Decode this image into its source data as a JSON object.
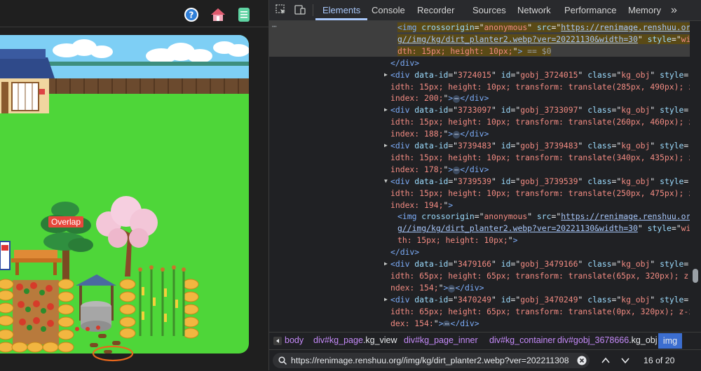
{
  "page": {
    "overlap_label": "Overlap"
  },
  "top_icons": [
    "help-icon",
    "home-icon",
    "notes-icon"
  ],
  "devtools": {
    "tabs": [
      {
        "label": "Elements",
        "active": true
      },
      {
        "label": "Console"
      },
      {
        "label": "Recorder"
      },
      {
        "label": "Sources"
      },
      {
        "label": "Network"
      },
      {
        "label": "Performance"
      },
      {
        "label": "Memory"
      }
    ],
    "more_tabs": "»",
    "code_lines": [
      {
        "segs": [
          [
            "tg",
            "<img "
          ],
          [
            "an",
            "crossorigin"
          ],
          [
            "pl",
            "=\""
          ],
          [
            "av",
            "anonymous"
          ],
          [
            "pl",
            "\" "
          ],
          [
            "an",
            "src"
          ],
          [
            "pl",
            "=\""
          ],
          [
            "lk",
            "https://renimage.renshuu.or"
          ]
        ],
        "indent": 183
      },
      {
        "segs": [
          [
            "lk",
            "g//img/kg/dirt_planter2.webp?ver=20221130&width=30"
          ],
          [
            "pl",
            "\" "
          ],
          [
            "an",
            "style"
          ],
          [
            "pl",
            "=\""
          ],
          [
            "av",
            "wi"
          ]
        ],
        "indent": 183
      },
      {
        "segs": [
          [
            "av",
            "dth: 15px; height: 10px;"
          ],
          [
            "pl",
            "\""
          ],
          [
            "tg",
            ">"
          ],
          [
            "cm",
            " == $0"
          ]
        ],
        "indent": 183
      },
      {
        "segs": [
          [
            "tg",
            "</div>"
          ]
        ],
        "indent": 173
      },
      {
        "arrow": "▶",
        "segs": [
          [
            "tg",
            "<div "
          ],
          [
            "an",
            "data-id"
          ],
          [
            "pl",
            "=\""
          ],
          [
            "av",
            "3724015"
          ],
          [
            "pl",
            "\" "
          ],
          [
            "an",
            "id"
          ],
          [
            "pl",
            "=\""
          ],
          [
            "av",
            "gobj_3724015"
          ],
          [
            "pl",
            "\" "
          ],
          [
            "an",
            "class"
          ],
          [
            "pl",
            "=\""
          ],
          [
            "av",
            "kg_obj"
          ],
          [
            "pl",
            "\" "
          ],
          [
            "an",
            "style"
          ],
          [
            "pl",
            "=\""
          ],
          [
            "av",
            "w"
          ]
        ],
        "indent": 173
      },
      {
        "segs": [
          [
            "av",
            "idth: 15px; height: 10px; transform: translate(285px, 490px); z-"
          ]
        ],
        "indent": 173
      },
      {
        "segs": [
          [
            "av",
            "index: 200;"
          ],
          [
            "pl",
            "\""
          ],
          [
            "tg",
            ">"
          ],
          [
            "dots",
            "⋯"
          ],
          [
            "tg",
            "</div>"
          ]
        ],
        "indent": 173
      },
      {
        "arrow": "▶",
        "segs": [
          [
            "tg",
            "<div "
          ],
          [
            "an",
            "data-id"
          ],
          [
            "pl",
            "=\""
          ],
          [
            "av",
            "3733097"
          ],
          [
            "pl",
            "\" "
          ],
          [
            "an",
            "id"
          ],
          [
            "pl",
            "=\""
          ],
          [
            "av",
            "gobj_3733097"
          ],
          [
            "pl",
            "\" "
          ],
          [
            "an",
            "class"
          ],
          [
            "pl",
            "=\""
          ],
          [
            "av",
            "kg_obj"
          ],
          [
            "pl",
            "\" "
          ],
          [
            "an",
            "style"
          ],
          [
            "pl",
            "=\""
          ],
          [
            "av",
            "w"
          ]
        ],
        "indent": 173
      },
      {
        "segs": [
          [
            "av",
            "idth: 15px; height: 10px; transform: translate(260px, 460px); z-"
          ]
        ],
        "indent": 173
      },
      {
        "segs": [
          [
            "av",
            "index: 188;"
          ],
          [
            "pl",
            "\""
          ],
          [
            "tg",
            ">"
          ],
          [
            "dots",
            "⋯"
          ],
          [
            "tg",
            "</div>"
          ]
        ],
        "indent": 173
      },
      {
        "arrow": "▶",
        "segs": [
          [
            "tg",
            "<div "
          ],
          [
            "an",
            "data-id"
          ],
          [
            "pl",
            "=\""
          ],
          [
            "av",
            "3739483"
          ],
          [
            "pl",
            "\" "
          ],
          [
            "an",
            "id"
          ],
          [
            "pl",
            "=\""
          ],
          [
            "av",
            "gobj_3739483"
          ],
          [
            "pl",
            "\" "
          ],
          [
            "an",
            "class"
          ],
          [
            "pl",
            "=\""
          ],
          [
            "av",
            "kg_obj"
          ],
          [
            "pl",
            "\" "
          ],
          [
            "an",
            "style"
          ],
          [
            "pl",
            "=\""
          ],
          [
            "av",
            "w"
          ]
        ],
        "indent": 173
      },
      {
        "segs": [
          [
            "av",
            "idth: 15px; height: 10px; transform: translate(340px, 435px); z-"
          ]
        ],
        "indent": 173
      },
      {
        "segs": [
          [
            "av",
            "index: 178;"
          ],
          [
            "pl",
            "\""
          ],
          [
            "tg",
            ">"
          ],
          [
            "dots",
            "⋯"
          ],
          [
            "tg",
            "</div>"
          ]
        ],
        "indent": 173
      },
      {
        "arrow": "▼",
        "segs": [
          [
            "tg",
            "<div "
          ],
          [
            "an",
            "data-id"
          ],
          [
            "pl",
            "=\""
          ],
          [
            "av",
            "3739539"
          ],
          [
            "pl",
            "\" "
          ],
          [
            "an",
            "id"
          ],
          [
            "pl",
            "=\""
          ],
          [
            "av",
            "gobj_3739539"
          ],
          [
            "pl",
            "\" "
          ],
          [
            "an",
            "class"
          ],
          [
            "pl",
            "=\""
          ],
          [
            "av",
            "kg_obj"
          ],
          [
            "pl",
            "\" "
          ],
          [
            "an",
            "style"
          ],
          [
            "pl",
            "=\""
          ],
          [
            "av",
            "w"
          ]
        ],
        "indent": 173
      },
      {
        "segs": [
          [
            "av",
            "idth: 15px; height: 10px; transform: translate(250px, 475px); z-"
          ]
        ],
        "indent": 173
      },
      {
        "segs": [
          [
            "av",
            "index: 194;"
          ],
          [
            "pl",
            "\""
          ],
          [
            "tg",
            ">"
          ]
        ],
        "indent": 173
      },
      {
        "segs": [
          [
            "tg",
            "<img "
          ],
          [
            "an",
            "crossorigin"
          ],
          [
            "pl",
            "=\""
          ],
          [
            "av",
            "anonymous"
          ],
          [
            "pl",
            "\" "
          ],
          [
            "an",
            "src"
          ],
          [
            "pl",
            "=\""
          ],
          [
            "lk",
            "https://renimage.renshuu.or"
          ]
        ],
        "indent": 183
      },
      {
        "segs": [
          [
            "lk",
            "g//img/kg/dirt_planter2.webp?ver=20221130&width=30"
          ],
          [
            "pl",
            "\" "
          ],
          [
            "an",
            "style"
          ],
          [
            "pl",
            "=\""
          ],
          [
            "av",
            "wid"
          ]
        ],
        "indent": 183
      },
      {
        "segs": [
          [
            "av",
            "th: 15px; height: 10px;"
          ],
          [
            "pl",
            "\""
          ],
          [
            "tg",
            ">"
          ]
        ],
        "indent": 183
      },
      {
        "segs": [
          [
            "tg",
            "</div>"
          ]
        ],
        "indent": 173
      },
      {
        "arrow": "▶",
        "segs": [
          [
            "tg",
            "<div "
          ],
          [
            "an",
            "data-id"
          ],
          [
            "pl",
            "=\""
          ],
          [
            "av",
            "3479166"
          ],
          [
            "pl",
            "\" "
          ],
          [
            "an",
            "id"
          ],
          [
            "pl",
            "=\""
          ],
          [
            "av",
            "gobj_3479166"
          ],
          [
            "pl",
            "\" "
          ],
          [
            "an",
            "class"
          ],
          [
            "pl",
            "=\""
          ],
          [
            "av",
            "kg_obj"
          ],
          [
            "pl",
            "\" "
          ],
          [
            "an",
            "style"
          ],
          [
            "pl",
            "=\""
          ],
          [
            "av",
            "w"
          ]
        ],
        "indent": 173
      },
      {
        "segs": [
          [
            "av",
            "idth: 65px; height: 65px; transform: translate(65px, 320px); z-i"
          ]
        ],
        "indent": 173
      },
      {
        "segs": [
          [
            "av",
            "ndex: 154;"
          ],
          [
            "pl",
            "\""
          ],
          [
            "tg",
            ">"
          ],
          [
            "dots",
            "⋯"
          ],
          [
            "tg",
            "</div>"
          ]
        ],
        "indent": 173
      },
      {
        "arrow": "▶",
        "segs": [
          [
            "tg",
            "<div "
          ],
          [
            "an",
            "data-id"
          ],
          [
            "pl",
            "=\""
          ],
          [
            "av",
            "3470249"
          ],
          [
            "pl",
            "\" "
          ],
          [
            "an",
            "id"
          ],
          [
            "pl",
            "=\""
          ],
          [
            "av",
            "gobj_3470249"
          ],
          [
            "pl",
            "\" "
          ],
          [
            "an",
            "class"
          ],
          [
            "pl",
            "=\""
          ],
          [
            "av",
            "kg_obj"
          ],
          [
            "pl",
            "\" "
          ],
          [
            "an",
            "style"
          ],
          [
            "pl",
            "=\""
          ],
          [
            "av",
            "w"
          ]
        ],
        "indent": 173
      },
      {
        "segs": [
          [
            "av",
            "idth: 65px; height: 65px; transform: translate(0px, 320px); z-in"
          ]
        ],
        "indent": 173
      },
      {
        "segs": [
          [
            "av",
            "dex: 154;"
          ],
          [
            "pl",
            "\""
          ],
          [
            "tg",
            ">"
          ],
          [
            "dots",
            "⋯"
          ],
          [
            "tg",
            "</div>"
          ]
        ],
        "indent": 173
      }
    ],
    "breadcrumbs": [
      {
        "tag": "body",
        "cls": ""
      },
      {
        "tag": "div#kg_page",
        "cls": ".kg_view"
      },
      {
        "tag": "div#kg_page_inner",
        "cls": ""
      },
      {
        "tag": "div#kg_container",
        "cls": ""
      },
      {
        "tag": "div#gobj_3678666",
        "cls": ".kg_obj"
      }
    ],
    "breadcrumb_last": "img",
    "search": {
      "value": "https://renimage.renshuu.org//img/kg/dirt_planter2.webp?ver=202211308",
      "count": "16 of 20"
    }
  },
  "colors": {
    "grass": "#4ed639",
    "sky": "#7ecff5",
    "fence": "#6b4a2e",
    "devtools_bg": "#202124",
    "accent": "#a8c7fa",
    "highlight_orange": "#e8671c"
  }
}
